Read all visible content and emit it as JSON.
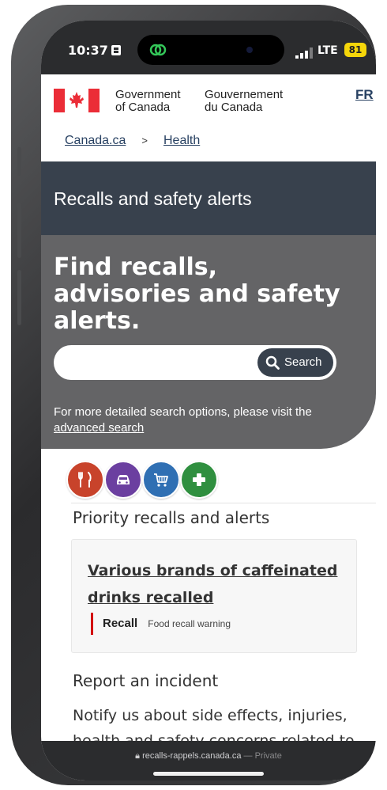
{
  "status_bar": {
    "time": "10:37",
    "network": "LTE",
    "battery": "81"
  },
  "header": {
    "gov_en_line1": "Government",
    "gov_en_line2": "of Canada",
    "gov_fr_line1": "Gouvernement",
    "gov_fr_line2": "du Canada",
    "language_toggle": "FR"
  },
  "breadcrumb": {
    "items": [
      "Canada.ca",
      "Health"
    ],
    "separator": ">"
  },
  "page_title": "Recalls and safety alerts",
  "hero": {
    "heading": "Find recalls, advisories and safety alerts.",
    "search_placeholder": "",
    "search_button": "Search",
    "note_prefix": "For more detailed search options, please visit the",
    "note_link": "advanced search"
  },
  "categories": [
    {
      "name": "food",
      "icon": "fork-knife-icon",
      "color": "#c8432b"
    },
    {
      "name": "vehicles",
      "icon": "car-icon",
      "color": "#6b3fa0"
    },
    {
      "name": "consumer-products",
      "icon": "shopping-cart-icon",
      "color": "#2f6fb3"
    },
    {
      "name": "health-products",
      "icon": "plus-icon",
      "color": "#2f8f3f"
    }
  ],
  "priority": {
    "heading": "Priority recalls and alerts",
    "items": [
      {
        "title": "Various brands of caffeinated drinks recalled",
        "label": "Recall",
        "type": "Food recall warning",
        "accent": "#d3080c"
      }
    ]
  },
  "report": {
    "heading": "Report an incident",
    "text": "Notify us about side effects, injuries, health and safety concerns related to"
  },
  "browser": {
    "url": "recalls-rappels.canada.ca",
    "mode": "— Private"
  }
}
